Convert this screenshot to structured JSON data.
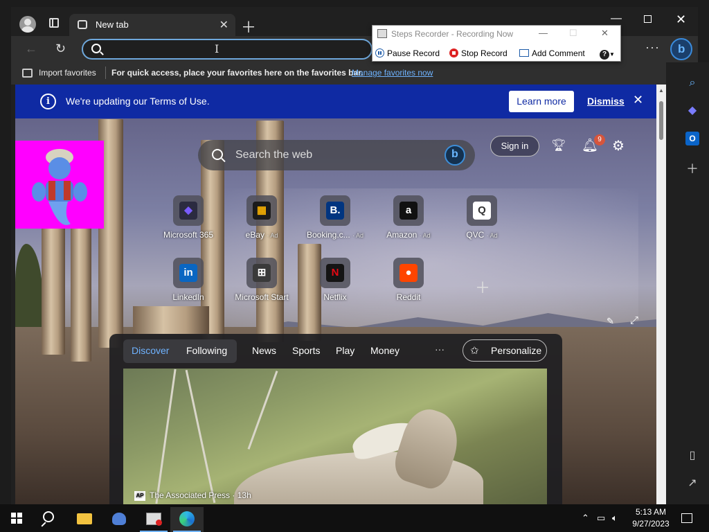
{
  "browser": {
    "tab_title": "New tab",
    "address_value": "",
    "favorites_bar": {
      "import_label": "Import favorites",
      "quick_access_text": "For quick access, place your favorites here on the favorites bar.",
      "manage_link": "Manage favorites now"
    }
  },
  "steps_recorder": {
    "title": "Steps Recorder - Recording Now",
    "pause_label": "Pause Record",
    "stop_label": "Stop Record",
    "comment_label": "Add Comment",
    "help_label": "?"
  },
  "banner": {
    "text": "We're updating our Terms of Use.",
    "learn_more": "Learn more",
    "dismiss": "Dismiss"
  },
  "newtab": {
    "search_placeholder": "Search the web",
    "sign_in": "Sign in",
    "notification_count": "9",
    "quick_links": [
      {
        "label": "Microsoft 365",
        "ad": "",
        "glyph": "◆",
        "color": "#7a5cff",
        "bg": "#2b2b40"
      },
      {
        "label": "eBay",
        "ad": "· Ad",
        "glyph": "▦",
        "color": "#f5af02",
        "bg": "#1b1b1b"
      },
      {
        "label": "Booking.c...",
        "ad": "· Ad",
        "glyph": "B.",
        "color": "#ffffff",
        "bg": "#003580"
      },
      {
        "label": "Amazon",
        "ad": "· Ad",
        "glyph": "a",
        "color": "#ffffff",
        "bg": "#111111"
      },
      {
        "label": "QVC",
        "ad": "· Ad",
        "glyph": "Q",
        "color": "#333333",
        "bg": "#ffffff"
      },
      {
        "label": "LinkedIn",
        "ad": "",
        "glyph": "in",
        "color": "#ffffff",
        "bg": "#0a66c2"
      },
      {
        "label": "Microsoft Start",
        "ad": "",
        "glyph": "⊞",
        "color": "#ffffff",
        "bg": "#3a3a3a"
      },
      {
        "label": "Netflix",
        "ad": "",
        "glyph": "N",
        "color": "#e50914",
        "bg": "#141414"
      },
      {
        "label": "Reddit",
        "ad": "",
        "glyph": "●",
        "color": "#ffffff",
        "bg": "#ff4500"
      }
    ]
  },
  "feed": {
    "tabs": [
      "Discover",
      "Following",
      "News",
      "Sports",
      "Play",
      "Money"
    ],
    "more": "···",
    "personalize": "Personalize",
    "article_source": "The Associated Press · 13h",
    "source_logo": "AP"
  },
  "taskbar": {
    "time": "5:13 AM",
    "date": "9/27/2023"
  },
  "icons": {
    "back": "back-arrow-icon",
    "refresh": "refresh-icon",
    "search": "search-icon",
    "copilot": "bing-copilot-icon",
    "settings": "gear-icon",
    "notifications": "bell-icon",
    "rewards": "trophy-icon"
  },
  "colors": {
    "banner_bg": "#0f2aa3",
    "accent": "#6fb3ff",
    "genie_bg": "#ff00ff",
    "stop_red": "#dd2222"
  }
}
